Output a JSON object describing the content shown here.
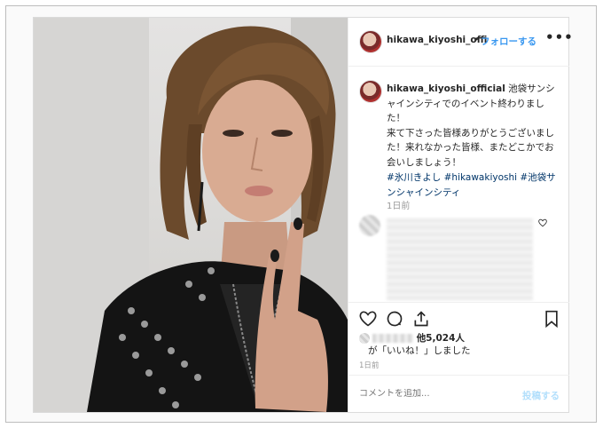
{
  "post": {
    "header": {
      "username": "hikawa_kiyoshi_offi",
      "separator": "•",
      "follow_label": "フォローする",
      "more_label": "•••"
    },
    "caption": {
      "username": "hikawa_kiyoshi_official",
      "text": " 池袋サンシャインシティでのイベント終わりました！\n来て下さった皆様ありがとうございました！来れなかった皆様、またどこかでお会いしましょう！",
      "hashtags": "#氷川きよし #hikawakiyoshi #池袋サンシャインシティ",
      "time": "1日前"
    },
    "likes": {
      "count_text": "他5,024人",
      "suffix_text": "が「いいね！」しました",
      "time": "1日前"
    },
    "comment": {
      "placeholder": "コメントを追加...",
      "post_label": "投稿する"
    }
  }
}
